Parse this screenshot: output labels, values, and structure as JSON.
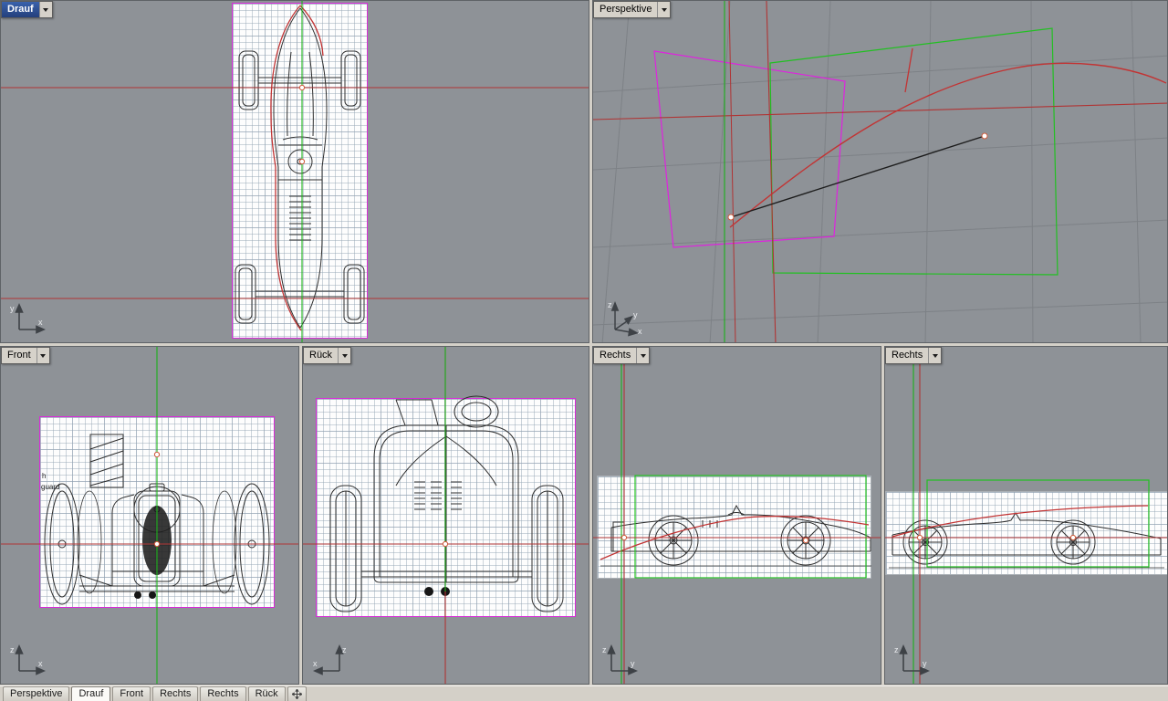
{
  "colors": {
    "viewport_bg": "#8e9297",
    "axis_red": "#b03434",
    "axis_green": "#1bb11b",
    "plane_magenta": "#df22df",
    "plane_green": "#22c022",
    "traced_curve_red": "#c23434",
    "active_title_bg": "#24407c"
  },
  "viewports": {
    "drauf": {
      "label": "Drauf",
      "active": true,
      "axis": {
        "v": "y",
        "h": "x"
      }
    },
    "perspektive": {
      "label": "Perspektive",
      "active": false,
      "axis": {
        "a": "z",
        "b": "y",
        "c": "x"
      }
    },
    "front": {
      "label": "Front",
      "active": false,
      "axis": {
        "v": "z",
        "h": "x"
      },
      "annotations": [
        "h",
        "guard"
      ]
    },
    "rueck": {
      "label": "Rück",
      "active": false,
      "axis": {
        "v": "z",
        "h": "x"
      }
    },
    "rechts1": {
      "label": "Rechts",
      "active": false,
      "axis": {
        "v": "z",
        "h": "y"
      }
    },
    "rechts2": {
      "label": "Rechts",
      "active": false,
      "axis": {
        "v": "z",
        "h": "y"
      }
    }
  },
  "tabs": [
    {
      "label": "Perspektive",
      "active": false
    },
    {
      "label": "Drauf",
      "active": true
    },
    {
      "label": "Front",
      "active": false
    },
    {
      "label": "Rechts",
      "active": false
    },
    {
      "label": "Rechts",
      "active": false
    },
    {
      "label": "Rück",
      "active": false
    }
  ]
}
